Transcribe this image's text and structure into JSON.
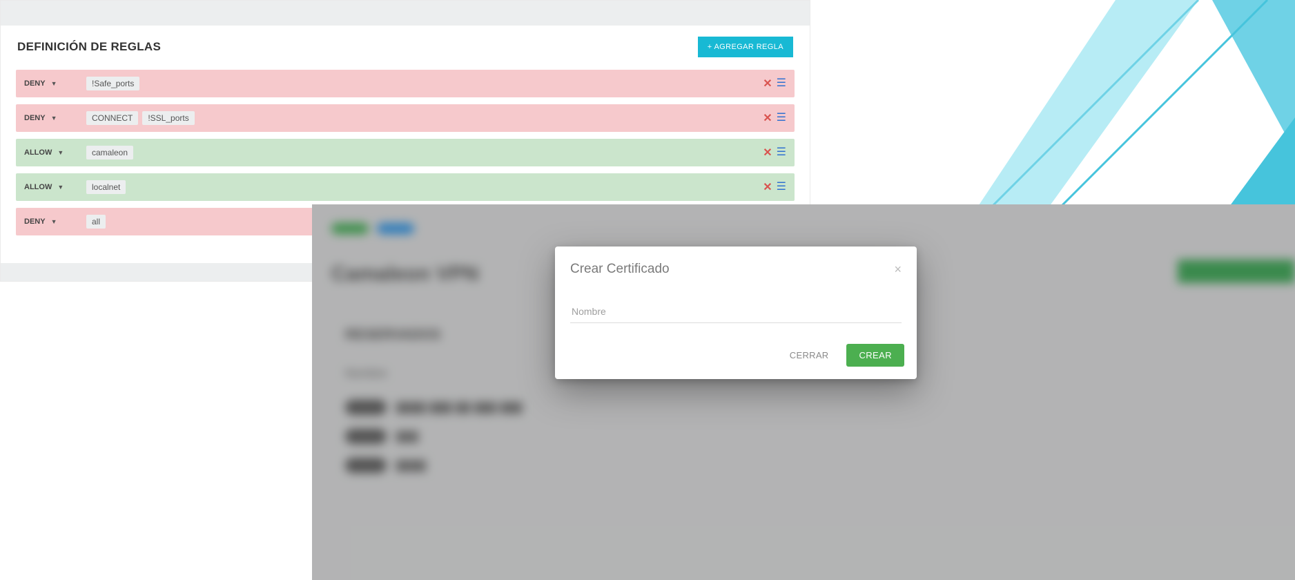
{
  "rules": {
    "title": "DEFINICIÓN DE REGLAS",
    "add_btn": "+ AGREGAR REGLA",
    "items": [
      {
        "type": "deny",
        "action": "DENY",
        "tags": [
          "!Safe_ports"
        ]
      },
      {
        "type": "deny",
        "action": "DENY",
        "tags": [
          "CONNECT",
          "!SSL_ports"
        ]
      },
      {
        "type": "allow",
        "action": "ALLOW",
        "tags": [
          "camaleon"
        ]
      },
      {
        "type": "allow",
        "action": "ALLOW",
        "tags": [
          "localnet"
        ]
      },
      {
        "type": "deny",
        "action": "DENY",
        "tags": [
          "all"
        ]
      }
    ]
  },
  "vpn": {
    "page_title": "Camaleon VPN",
    "section": "RESERVADOS",
    "col_header": "Nombre"
  },
  "modal": {
    "title": "Crear Certificado",
    "placeholder": "Nombre",
    "cancel": "CERRAR",
    "confirm": "CREAR"
  }
}
